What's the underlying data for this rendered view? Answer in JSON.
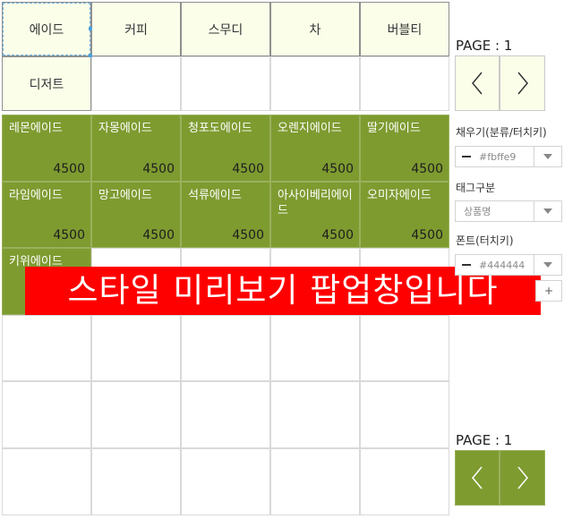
{
  "categories": [
    {
      "label": "에이드"
    },
    {
      "label": "커피"
    },
    {
      "label": "스무디"
    },
    {
      "label": "차"
    },
    {
      "label": "버블티"
    },
    {
      "label": "디저트"
    },
    {
      "label": ""
    },
    {
      "label": ""
    },
    {
      "label": ""
    },
    {
      "label": ""
    }
  ],
  "products": [
    {
      "name": "레몬에이드",
      "price": "4500"
    },
    {
      "name": "자몽에이드",
      "price": "4500"
    },
    {
      "name": "청포도에이드",
      "price": "4500"
    },
    {
      "name": "오렌지에이드",
      "price": "4500"
    },
    {
      "name": "딸기에이드",
      "price": "4500"
    },
    {
      "name": "라임에이드",
      "price": "4500"
    },
    {
      "name": "망고에이드",
      "price": "4500"
    },
    {
      "name": "석류에이드",
      "price": "4500"
    },
    {
      "name": "아사이베리에이드",
      "price": "4500"
    },
    {
      "name": "오미자에이드",
      "price": "4500"
    },
    {
      "name": "키위에이드",
      "price": ""
    }
  ],
  "banner": {
    "text": "스타일 미리보기 팝업창입니다"
  },
  "category_pager": {
    "label": "PAGE : 1"
  },
  "product_pager": {
    "label": "PAGE : 1"
  },
  "style_panel": {
    "fill_label": "채우기(분류/터치키)",
    "fill_value": "#fbffe9",
    "tag_label": "태그구분",
    "tag_value": "상품명",
    "font_label": "폰트(터치키)",
    "font_value": "#444444",
    "plus_label": "+"
  },
  "colors": {
    "category_fill": "#fbffe9",
    "product_fill": "#7e9b30",
    "banner": "#ff0000"
  }
}
